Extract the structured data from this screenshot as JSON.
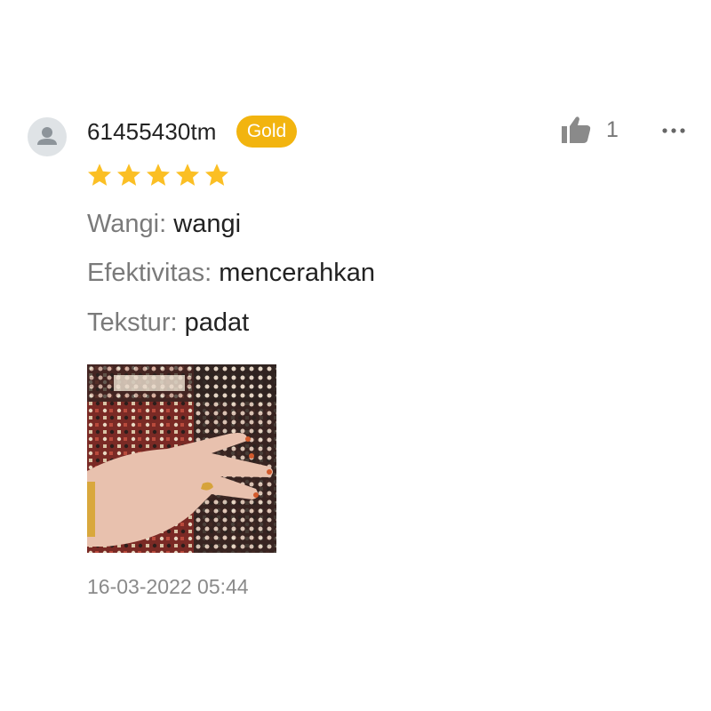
{
  "review": {
    "username": "61455430tm",
    "badge": "Gold",
    "like_count": "1",
    "rating": 5,
    "attributes": [
      {
        "label": "Wangi:",
        "value": "wangi"
      },
      {
        "label": "Efektivitas:",
        "value": "mencerahkan"
      },
      {
        "label": "Tekstur:",
        "value": "padat"
      }
    ],
    "timestamp": "16-03-2022 05:44"
  },
  "colors": {
    "badge": "#f2b40f",
    "star": "#fbbf24",
    "muted_text": "#7a7a7a",
    "main_text": "#222222"
  },
  "icons": {
    "avatar": "user-silhouette-icon",
    "like": "thumbs-up-icon",
    "more": "more-dots-icon",
    "star": "star-icon"
  }
}
